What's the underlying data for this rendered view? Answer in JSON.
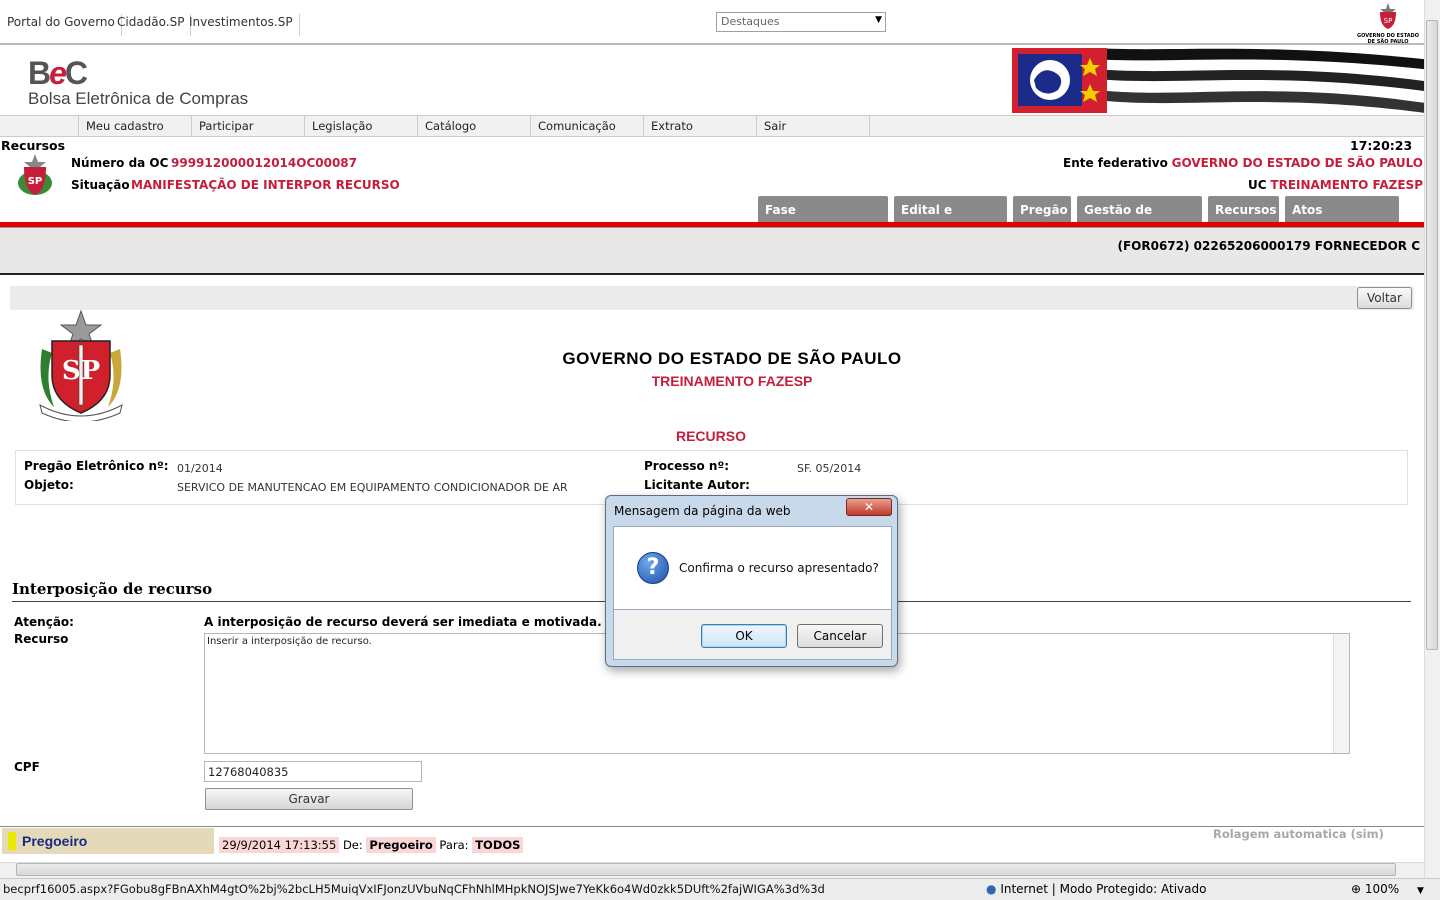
{
  "portal": {
    "links": [
      "Portal do Governo",
      "Cidadão.SP",
      "Investimentos.SP"
    ],
    "destaques": "Destaques",
    "gov_logo_text": [
      "GOVERNO DO ESTADO",
      "DE SÃO PAULO"
    ]
  },
  "header": {
    "logo_b": "B",
    "logo_e": "e",
    "logo_c": "C",
    "name": "Bolsa Eletrônica de Compras"
  },
  "menu": [
    "Meu cadastro",
    "Participar",
    "Legislação",
    "Catálogo",
    "Comunicação",
    "Extrato",
    "Sair"
  ],
  "status": {
    "section": "Recursos",
    "time": "17:20:23",
    "oc_label": "Número da OC",
    "oc_value": "999912000012014OC00087",
    "situacao_label": "Situação",
    "situacao_value": "MANIFESTAÇÃO DE INTERPOR RECURSO",
    "ente_label": "Ente federativo",
    "ente_value": "GOVERNO DO ESTADO DE SÃO PAULO",
    "uc_label": "UC",
    "uc_value": "TREINAMENTO FAZESP"
  },
  "tabs": [
    "Fase Preparatória",
    "Edital e Anexos",
    "Pregão",
    "Gestão de Prazos",
    "Recursos",
    "Atos Decisórios"
  ],
  "user": "(FOR0672) 02265206000179 FORNECEDOR C",
  "content": {
    "voltar": "Voltar",
    "gov_title": "GOVERNO DO ESTADO DE SÃO PAULO",
    "gov_sub": "TREINAMENTO FAZESP",
    "doc_title": "RECURSO",
    "pregao_label": "Pregão Eletrônico nº:",
    "pregao_value": "01/2014",
    "objeto_label": "Objeto:",
    "objeto_value": "SERVICO DE MANUTENCAO EM EQUIPAMENTO CONDICIONADOR DE AR",
    "processo_label": "Processo nº:",
    "processo_value": "SF. 05/2014",
    "licitante_label": "Licitante Autor:",
    "section_title": "Interposição de recurso",
    "atencao_label": "Atenção:",
    "atencao_value": "A interposição de recurso deverá ser imediata e motivada.",
    "recurso_label": "Recurso",
    "recurso_text": "Inserir a interposição de recurso.",
    "cpf_label": "CPF",
    "cpf_value": "12768040835",
    "gravar": "Gravar"
  },
  "chat": {
    "tab": "Pregoeiro",
    "rolagem": "Rolagem automatica (sim)",
    "timestamp": "29/9/2014 17:13:55",
    "de_label": "De:",
    "de_value": "Pregoeiro",
    "para_label": "Para:",
    "para_value": "TODOS"
  },
  "statusbar": {
    "url": "becprf16005.aspx?FGobu8gFBnAXhM4gtO%2bj%2bcLH5MuiqVxIFJonzUVbuNqCFhNhlMHpkNOJSJwe7YeKk6o4Wd0zkk5DUft%2fajWIGA%3d%3d",
    "zone": "Internet | Modo Protegido: Ativado",
    "zoom": "100%"
  },
  "dialog": {
    "title": "Mensagem da página da web",
    "close": "✕",
    "message": "Confirma o recurso apresentado?",
    "ok": "OK",
    "cancel": "Cancelar"
  }
}
